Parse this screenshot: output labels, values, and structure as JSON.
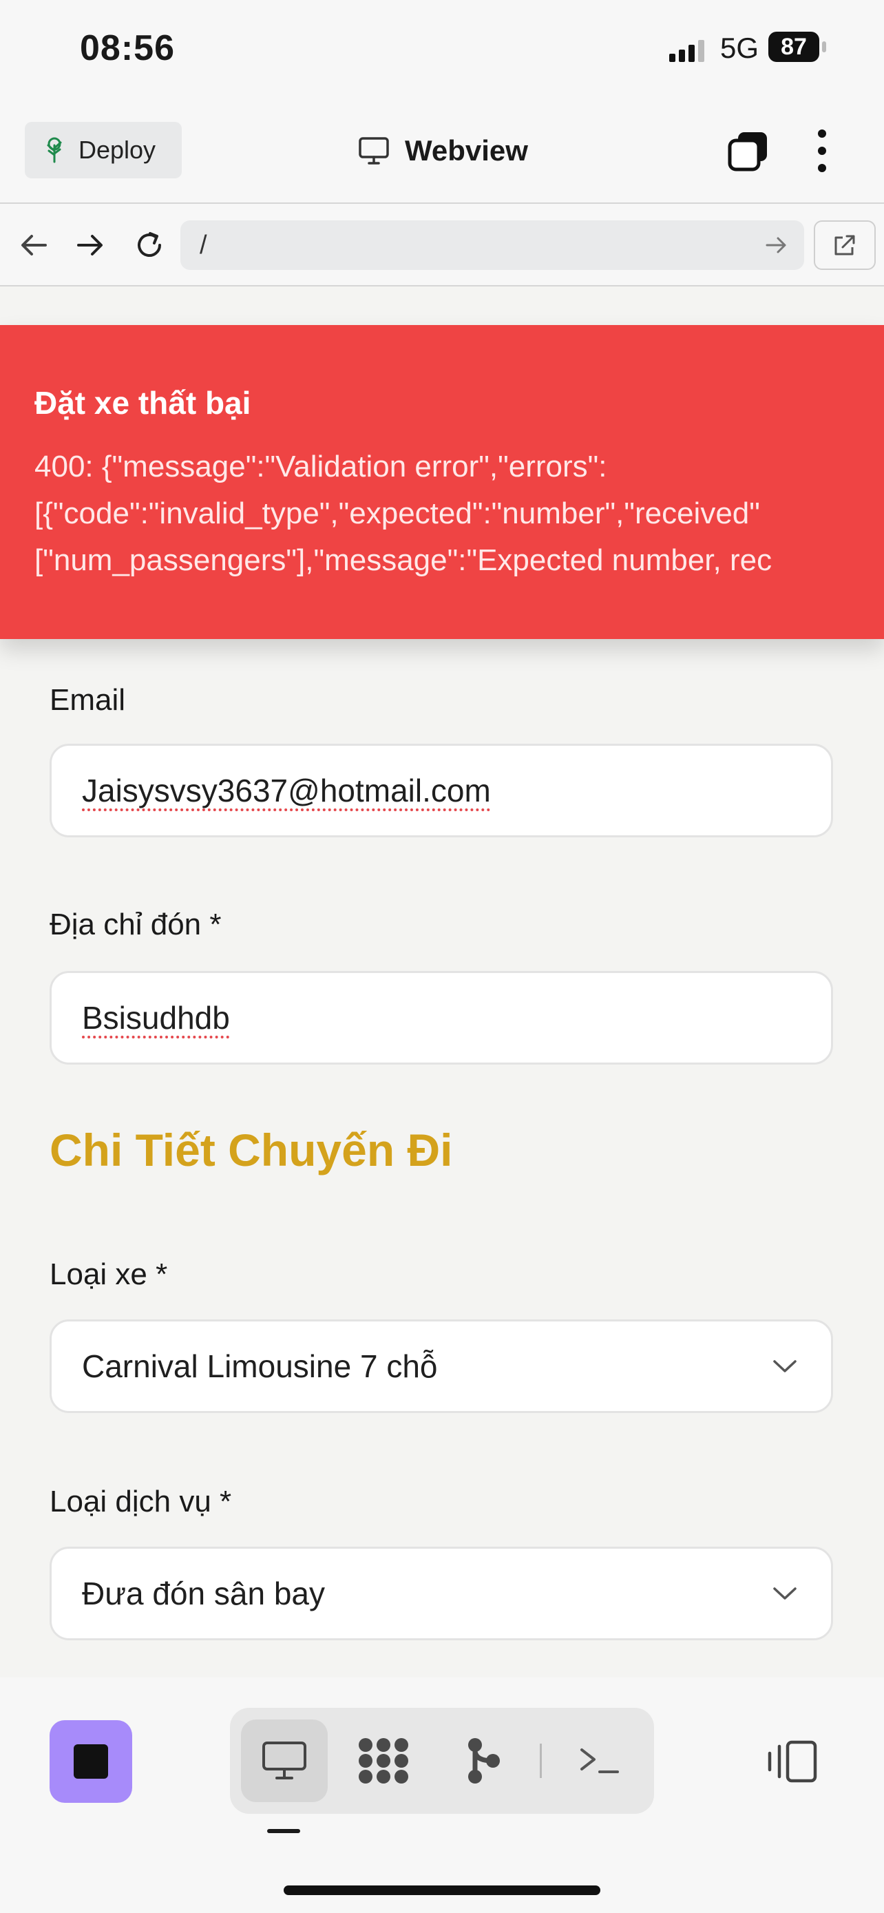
{
  "status_bar": {
    "time": "08:56",
    "network": "5G",
    "battery": "87"
  },
  "app_bar": {
    "deploy_label": "Deploy",
    "title": "Webview"
  },
  "url_bar": {
    "url": "/"
  },
  "toast": {
    "title": "Đặt xe thất bại",
    "lines": [
      "400: {\"message\":\"Validation error\",\"errors\":",
      "[{\"code\":\"invalid_type\",\"expected\":\"number\",\"received\"",
      "[\"num_passengers\"],\"message\":\"Expected number, rec"
    ]
  },
  "form": {
    "email_label": "Email",
    "email_value": "Jaisysvsy3637@hotmail.com",
    "pickup_label": "Địa chỉ đón *",
    "pickup_value": "Bsisudhdb",
    "section_title": "Chi Tiết Chuyến Đi",
    "vehicle_label": "Loại xe *",
    "vehicle_value": "Carnival Limousine 7 chỗ",
    "service_label": "Loại dịch vụ *",
    "service_value": "Đưa đón sân bay"
  },
  "colors": {
    "toast_bg": "#ef4444",
    "section_title": "#d4a21c",
    "stop_button": "#a78bfa"
  },
  "icons": [
    "deploy-icon",
    "monitor-icon",
    "tabs-icon",
    "more-icon",
    "back-icon",
    "forward-icon",
    "reload-icon",
    "go-arrow-icon",
    "external-link-icon",
    "stop-icon",
    "webview-icon",
    "workspace-icon",
    "git-icon",
    "terminal-icon",
    "panel-icon"
  ]
}
